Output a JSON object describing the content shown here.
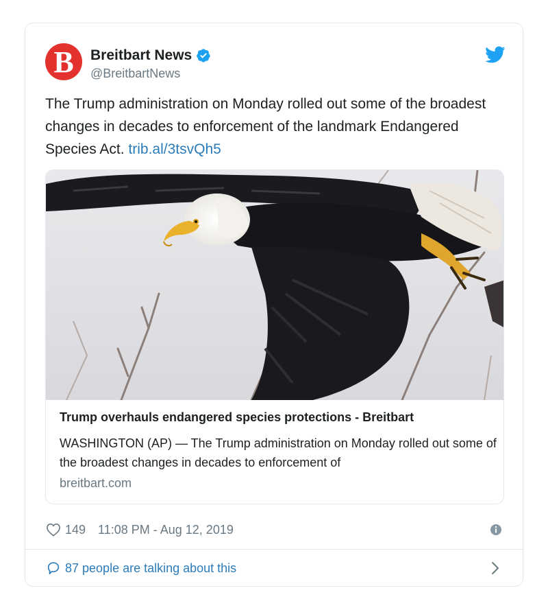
{
  "author": {
    "avatar_letter": "B",
    "name": "Breitbart News",
    "handle": "@BreitbartNews",
    "verified": true
  },
  "tweet": {
    "text": "The Trump administration on Monday rolled out some of the broadest changes in decades to enforcement of the landmark Endangered Species Act.",
    "link": "trib.al/3tsvQh5"
  },
  "link_card": {
    "image_alt": "bald eagle in flight",
    "title": "Trump overhauls endangered species protections - Breitbart",
    "description": "WASHINGTON (AP) — The Trump administration on Monday rolled out some of the broadest changes in decades to enforcement of",
    "domain": "breitbart.com"
  },
  "footer": {
    "like_count": "149",
    "timestamp": "11:08 PM - Aug 12, 2019",
    "talking": "87 people are talking about this"
  },
  "icons": {
    "brand": "twitter-bird-icon",
    "verified": "verified-badge-icon",
    "like": "heart-icon",
    "info": "info-icon",
    "talking": "speech-bubble-icon",
    "expand": "chevron-right-icon"
  },
  "colors": {
    "avatar_bg": "#e3322d",
    "twitter_blue": "#1da1f2",
    "link": "#2b7bb9",
    "muted": "#697882",
    "border": "#e1e8ed"
  }
}
